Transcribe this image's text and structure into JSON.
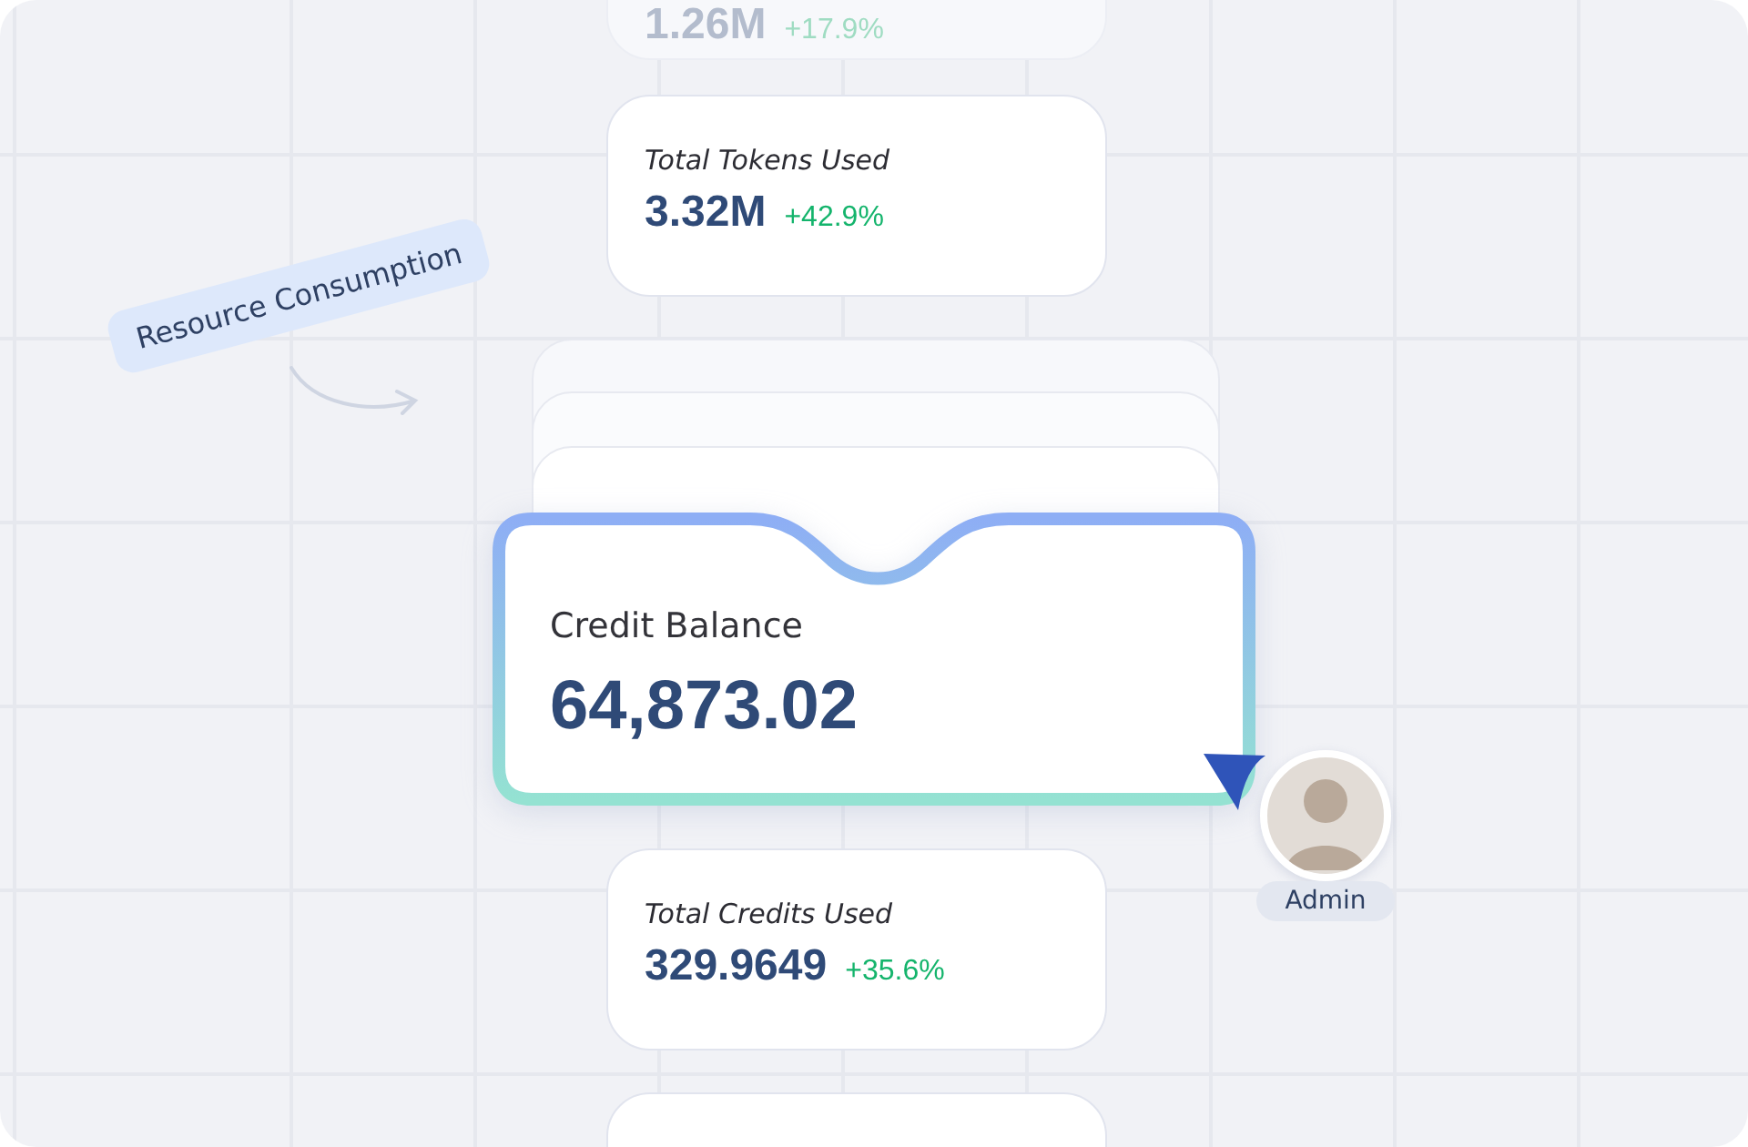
{
  "stat_cards": [
    {
      "kind": "stat",
      "faded": true,
      "value": "1.26M",
      "change": "+17.9%"
    },
    {
      "kind": "stat",
      "faded": false,
      "label": "Total Tokens Used",
      "value": "3.32M",
      "change": "+42.9%"
    },
    {
      "kind": "stat",
      "faded": false,
      "label": "Total Credits Used",
      "value": "329.9649",
      "change": "+35.6%"
    },
    {
      "kind": "blank"
    }
  ],
  "tag": {
    "label": "Resource Consumption"
  },
  "balance_card": {
    "label": "Credit Balance",
    "value": "64,873.02"
  },
  "user": {
    "role": "Admin"
  }
}
